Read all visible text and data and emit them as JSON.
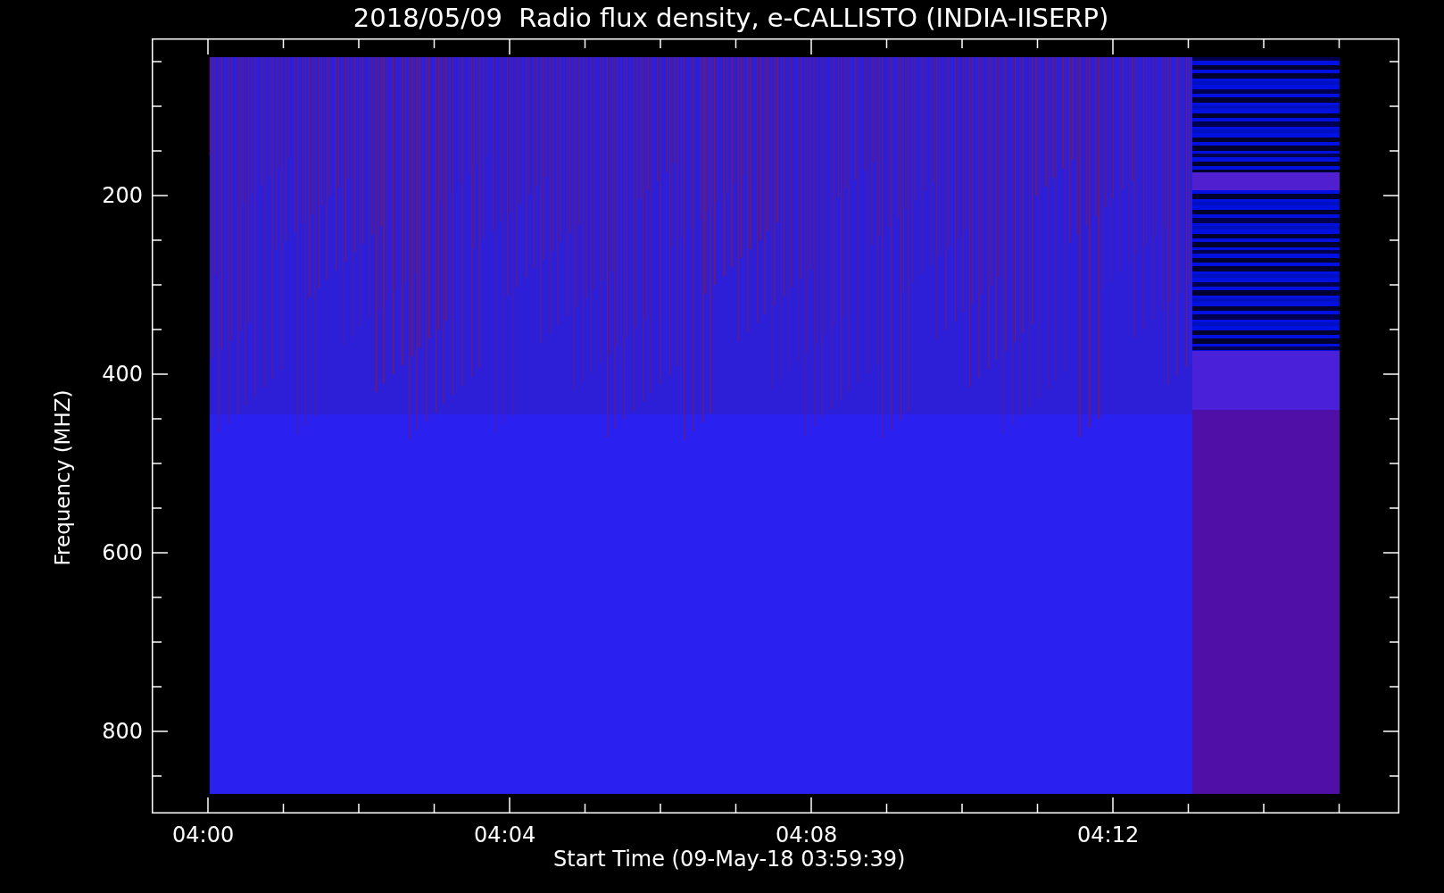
{
  "title": "2018/05/09  Radio flux density, e-CALLISTO (INDIA-IISERP)",
  "y_axis": {
    "label": "Frequency (MHZ)",
    "ticks": [
      "200",
      "400",
      "600",
      "800"
    ]
  },
  "x_axis": {
    "label": "Start Time (09-May-18 03:59:39)",
    "ticks": [
      "04:00",
      "04:04",
      "04:08",
      "04:12"
    ]
  }
}
